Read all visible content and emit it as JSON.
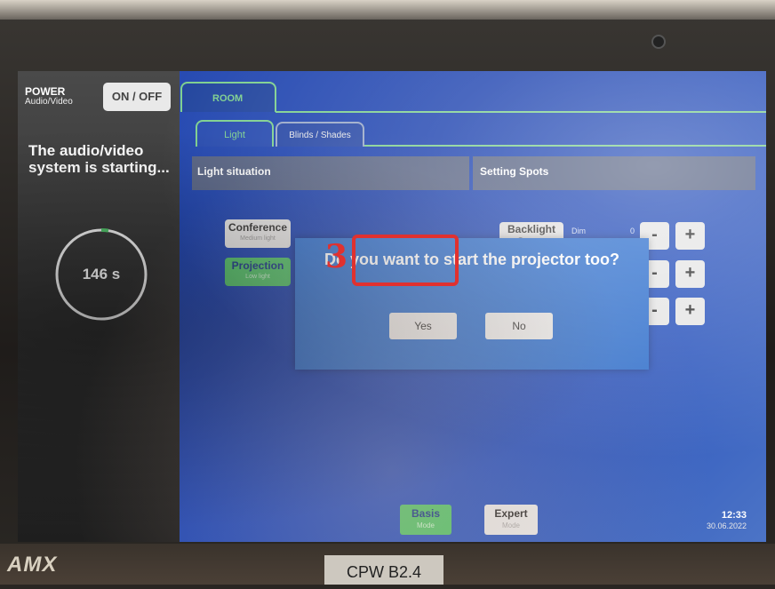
{
  "device": {
    "brand_logo": "AMX",
    "room_plate": "CPW B2.4"
  },
  "power": {
    "title": "POWER",
    "subtitle": "Audio/Video",
    "button_label": "ON / OFF",
    "status_text": "The audio/video system is starting...",
    "countdown_label": "146 s"
  },
  "tabs": {
    "main": "ROOM",
    "sub": [
      "Light",
      "Blinds / Shades"
    ]
  },
  "light_situation": {
    "header": "Light situation",
    "scenes": [
      {
        "label": "Conference",
        "sub": "Medium light",
        "active": false
      },
      {
        "label": "Projection",
        "sub": "Low light",
        "active": true
      }
    ]
  },
  "setting_spots": {
    "header": "Setting Spots",
    "backlight_label": "Backlight Stage",
    "dim_label": "Dim",
    "dim_value": "0",
    "minus": "-",
    "plus": "+"
  },
  "dialog": {
    "question": "Do you want to start the projector too?",
    "yes_label": "Yes",
    "no_label": "No"
  },
  "annotation": {
    "step_number": "3",
    "color": "#e0312f"
  },
  "modes": {
    "basis": {
      "label": "Basis",
      "sub": "Mode"
    },
    "expert": {
      "label": "Expert",
      "sub": "Mode"
    }
  },
  "clock": {
    "time": "12:33",
    "date": "30.06.2022"
  },
  "colors": {
    "accent_green": "#53c26b",
    "tab_green": "#7fd08f",
    "dialog_blue": "#3272cf",
    "screen_blue": "#2449b0"
  }
}
